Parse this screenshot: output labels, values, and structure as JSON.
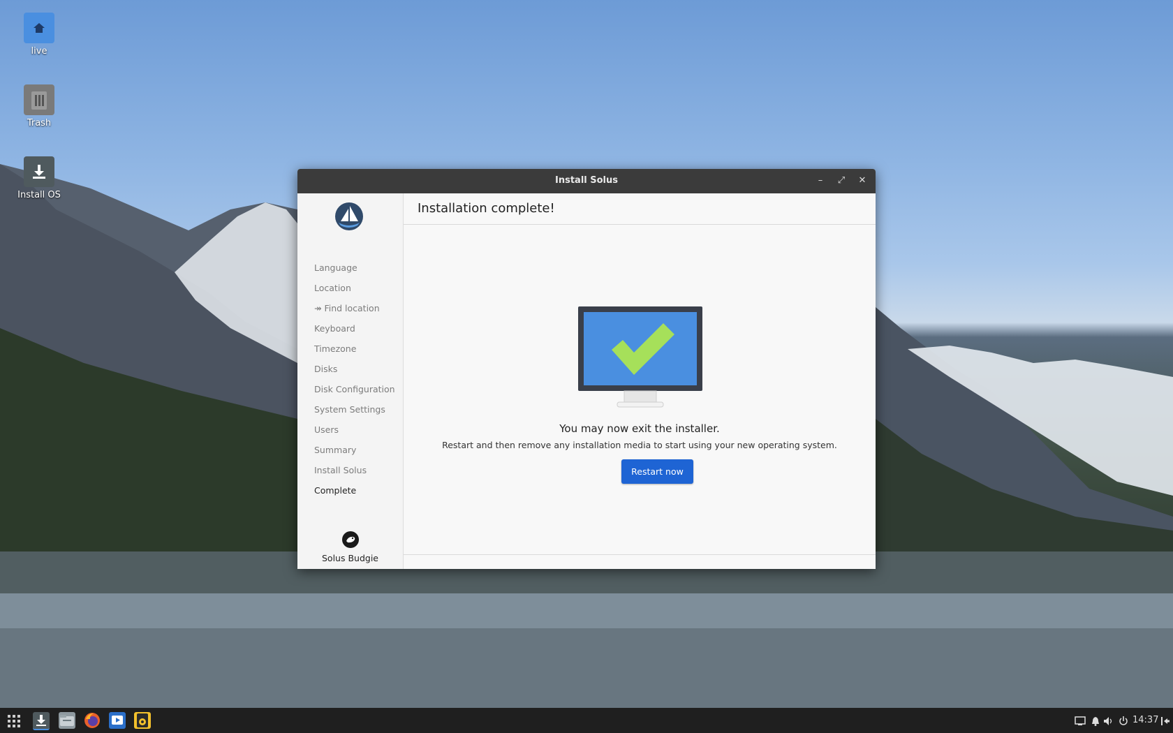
{
  "desktop": {
    "icons": [
      {
        "label": "live",
        "icon": "home-folder-icon"
      },
      {
        "label": "Trash",
        "icon": "trash-icon"
      },
      {
        "label": "Install OS",
        "icon": "install-icon"
      }
    ]
  },
  "window": {
    "title": "Install Solus",
    "controls": {
      "minimize": "–",
      "maximize": "⤢",
      "close": "✕"
    }
  },
  "sidebar": {
    "items": [
      {
        "label": "Language",
        "active": false
      },
      {
        "label": "Location",
        "active": false
      },
      {
        "label": "↠ Find location",
        "active": false
      },
      {
        "label": "Keyboard",
        "active": false
      },
      {
        "label": "Timezone",
        "active": false
      },
      {
        "label": "Disks",
        "active": false
      },
      {
        "label": "Disk Configuration",
        "active": false
      },
      {
        "label": "System Settings",
        "active": false
      },
      {
        "label": "Users",
        "active": false
      },
      {
        "label": "Summary",
        "active": false
      },
      {
        "label": "Install Solus",
        "active": false
      },
      {
        "label": "Complete",
        "active": true
      }
    ],
    "brand_label": "Solus Budgie"
  },
  "main": {
    "heading": "Installation complete!",
    "message": "You may now exit the installer.",
    "submessage": "Restart and then remove any installation media to start using your new operating system.",
    "restart_label": "Restart now"
  },
  "taskbar": {
    "clock": "14:37"
  },
  "colors": {
    "accent": "#1e64d4",
    "check": "#a6e05a",
    "screen": "#4a8fe0"
  }
}
